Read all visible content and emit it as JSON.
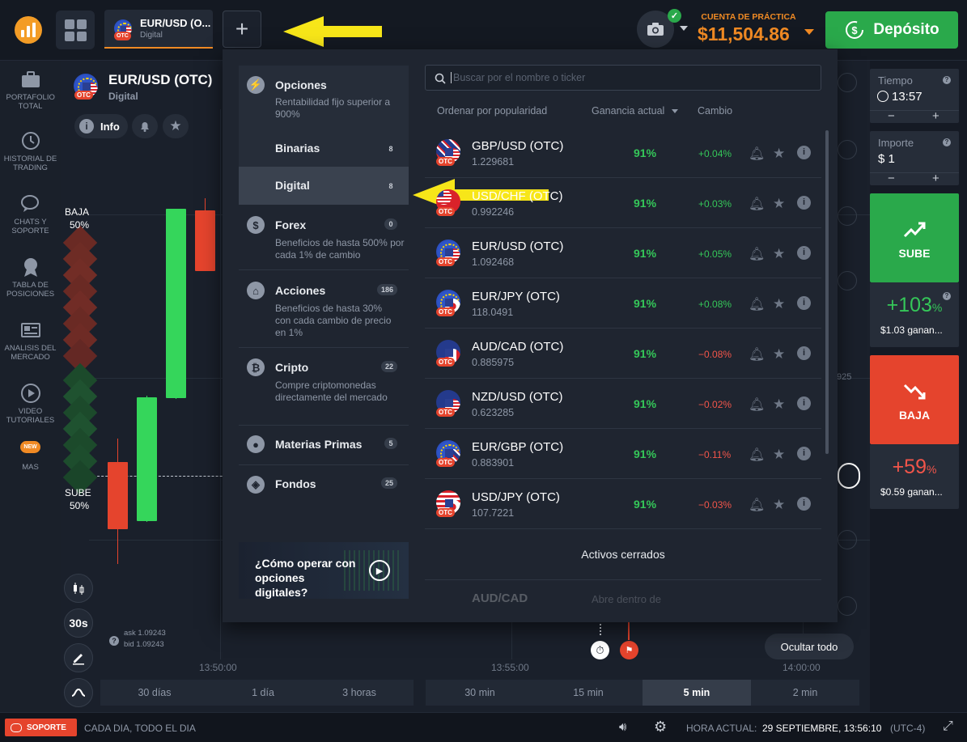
{
  "topbar": {
    "asset_tab": {
      "name": "EUR/USD (O...",
      "type": "Digital"
    },
    "account_label": "CUENTA DE PRÁCTICA",
    "balance": "$11,504.86",
    "deposit_label": "Depósito",
    "accent_color": "#f08a24",
    "deposit_color": "#2aa94b"
  },
  "leftbar": {
    "items": [
      {
        "label": "PORTAFOLIO TOTAL",
        "icon": "briefcase-icon"
      },
      {
        "label": "HISTORIAL DE TRADING",
        "icon": "history-icon"
      },
      {
        "label": "CHATS Y SOPORTE",
        "icon": "chat-icon"
      },
      {
        "label": "TABLA DE POSICIONES",
        "icon": "medal-icon"
      },
      {
        "label": "ANALISIS DEL MERCADO",
        "icon": "newspaper-icon"
      },
      {
        "label": "VIDEO TUTORIALES",
        "icon": "play-icon"
      },
      {
        "label": "MAS",
        "icon": "more-icon",
        "badge": "NEW"
      }
    ]
  },
  "chart": {
    "asset_title": "EUR/USD (OTC)",
    "asset_type": "Digital",
    "info_label": "Info",
    "baja_label": "BAJA",
    "baja_pct": "50%",
    "sube_label": "SUBE",
    "sube_pct": "50%",
    "ask": "ask 1.09243",
    "bid": "bid 1.09243",
    "expiry_label": "30s",
    "time_labels": [
      "13:50:00",
      "13:55:00",
      "14:00:00"
    ],
    "side_value": "925",
    "hide_all_label": "Ocultar todo"
  },
  "timeframes": [
    "30 días",
    "1 día",
    "3 horas",
    "30 min",
    "15 min",
    "5 min",
    "2 min"
  ],
  "timeframe_active": "5 min",
  "dropdown": {
    "categories": [
      {
        "title": "Opciones",
        "desc": "Rentabilidad fijo superior a 900%",
        "badge": "",
        "icon": "lightning-icon"
      },
      {
        "title": "Binarias",
        "desc": "",
        "badge": "8",
        "icon": ""
      },
      {
        "title": "Digital",
        "desc": "",
        "badge": "8",
        "icon": ""
      },
      {
        "title": "Forex",
        "desc": "Beneficios de hasta 500% por cada 1% de cambio",
        "badge": "0",
        "icon": "dollar-icon"
      },
      {
        "title": "Acciones",
        "desc": "Beneficios de hasta 30% con cada cambio de precio en 1%",
        "badge": "186",
        "icon": "bank-icon"
      },
      {
        "title": "Cripto",
        "desc": "Compre criptomonedas directamente del mercado",
        "badge": "22",
        "icon": "bitcoin-icon"
      },
      {
        "title": "Materias Primas",
        "desc": "",
        "badge": "5",
        "icon": "drop-icon"
      },
      {
        "title": "Fondos",
        "desc": "",
        "badge": "25",
        "icon": "cube-icon"
      }
    ],
    "promo_text": "¿Cómo operar con opciones digitales?",
    "search_placeholder": "Buscar por el nombre o ticker",
    "col_sort": "Ordenar por popularidad",
    "col_payout": "Ganancia actual",
    "col_change": "Cambio",
    "assets": [
      {
        "name": "GBP/USD (OTC)",
        "price": "1.229681",
        "payout": "91%",
        "change": "+0.04%"
      },
      {
        "name": "USD/CHF (OTC)",
        "price": "0.992246",
        "payout": "91%",
        "change": "+0.03%"
      },
      {
        "name": "EUR/USD (OTC)",
        "price": "1.092468",
        "payout": "91%",
        "change": "+0.05%"
      },
      {
        "name": "EUR/JPY (OTC)",
        "price": "118.0491",
        "payout": "91%",
        "change": "+0.08%"
      },
      {
        "name": "AUD/CAD (OTC)",
        "price": "0.885975",
        "payout": "91%",
        "change": "−0.08%"
      },
      {
        "name": "NZD/USD (OTC)",
        "price": "0.623285",
        "payout": "91%",
        "change": "−0.02%"
      },
      {
        "name": "EUR/GBP (OTC)",
        "price": "0.883901",
        "payout": "91%",
        "change": "−0.11%"
      },
      {
        "name": "USD/JPY (OTC)",
        "price": "107.7221",
        "payout": "91%",
        "change": "−0.03%"
      }
    ],
    "closed_label": "Activos cerrados",
    "closed_asset": {
      "name": "AUD/CAD",
      "status": "Abre dentro de"
    }
  },
  "rightpanel": {
    "time_label": "Tiempo",
    "time_value": "13:57",
    "amount_label": "Importe",
    "amount_value": "$ 1",
    "up_label": "SUBE",
    "up_pct": "+103",
    "up_profit": "$1.03 ganan...",
    "down_label": "BAJA",
    "down_pct": "+59",
    "down_profit": "$0.59 ganan...",
    "pct_sign": "%"
  },
  "statusbar": {
    "support_label": "SOPORTE",
    "support_note": "CADA DIA, TODO EL DIA",
    "time_label": "HORA ACTUAL:",
    "time_value": "29 SEPTIEMBRE, 13:56:10",
    "tz": "(UTC-4)"
  }
}
